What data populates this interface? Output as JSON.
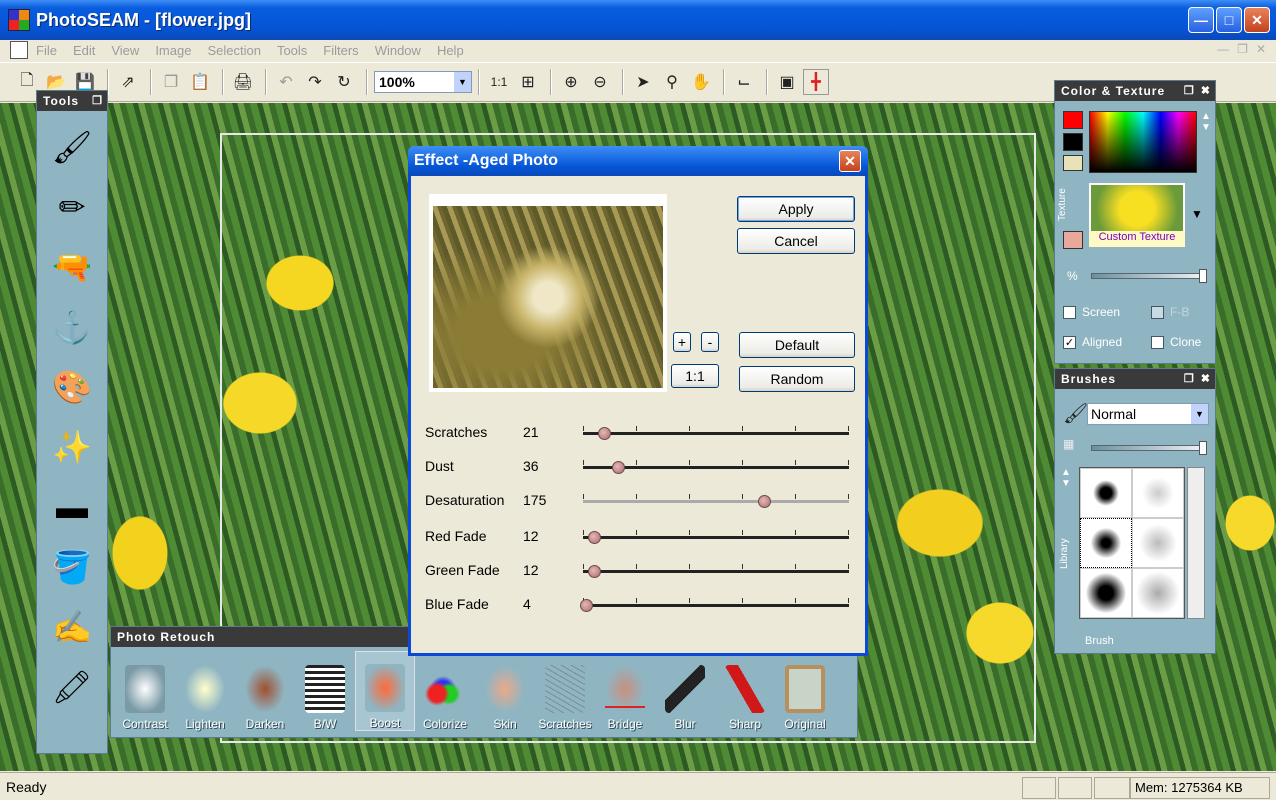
{
  "window": {
    "title": "PhotoSEAM - [flower.jpg]",
    "buttons": [
      "_",
      "□",
      "✕"
    ]
  },
  "menu": [
    "File",
    "Edit",
    "View",
    "Image",
    "Selection",
    "Tools",
    "Filters",
    "Window",
    "Help"
  ],
  "toolbar": {
    "zoom": "100%",
    "ratio_label": "1:1"
  },
  "tools_palette": {
    "title": "Tools"
  },
  "retouch_palette": {
    "title": "Photo Retouch",
    "items": [
      "Contrast",
      "Lighten",
      "Darken",
      "B/W",
      "Boost",
      "Colorize",
      "Skin",
      "Scratches",
      "Bridge",
      "Blur",
      "Sharp",
      "Original"
    ]
  },
  "color_texture": {
    "title": "Color & Texture",
    "texture_side_label": "Texture",
    "texture_name": "Custom Texture",
    "percent_label": "%",
    "options": {
      "screen": "Screen",
      "fb": "F-B",
      "aligned": "Aligned",
      "clone": "Clone"
    },
    "colors": {
      "primary": "#ff0000",
      "secondary": "#000000"
    }
  },
  "brushes": {
    "title": "Brushes",
    "mode": "Normal",
    "library_label": "Library",
    "footer": "Brush"
  },
  "dialog": {
    "title": "Effect -Aged Photo",
    "apply": "Apply",
    "cancel": "Cancel",
    "default": "Default",
    "random": "Random",
    "zoom_in": "+",
    "zoom_out": "-",
    "zoom_reset": "1:1",
    "params": [
      {
        "label": "Scratches",
        "value": "21",
        "level": 0.08
      },
      {
        "label": "Dust",
        "value": "36",
        "level": 0.13
      },
      {
        "label": "Desaturation",
        "value": "175",
        "level": 0.68
      },
      {
        "label": "Red Fade",
        "value": "12",
        "level": 0.04
      },
      {
        "label": "Green Fade",
        "value": "12",
        "level": 0.04
      },
      {
        "label": "Blue Fade",
        "value": "4",
        "level": 0.01
      }
    ]
  },
  "status": {
    "text": "Ready",
    "memory": "Mem: 1275364 KB"
  }
}
